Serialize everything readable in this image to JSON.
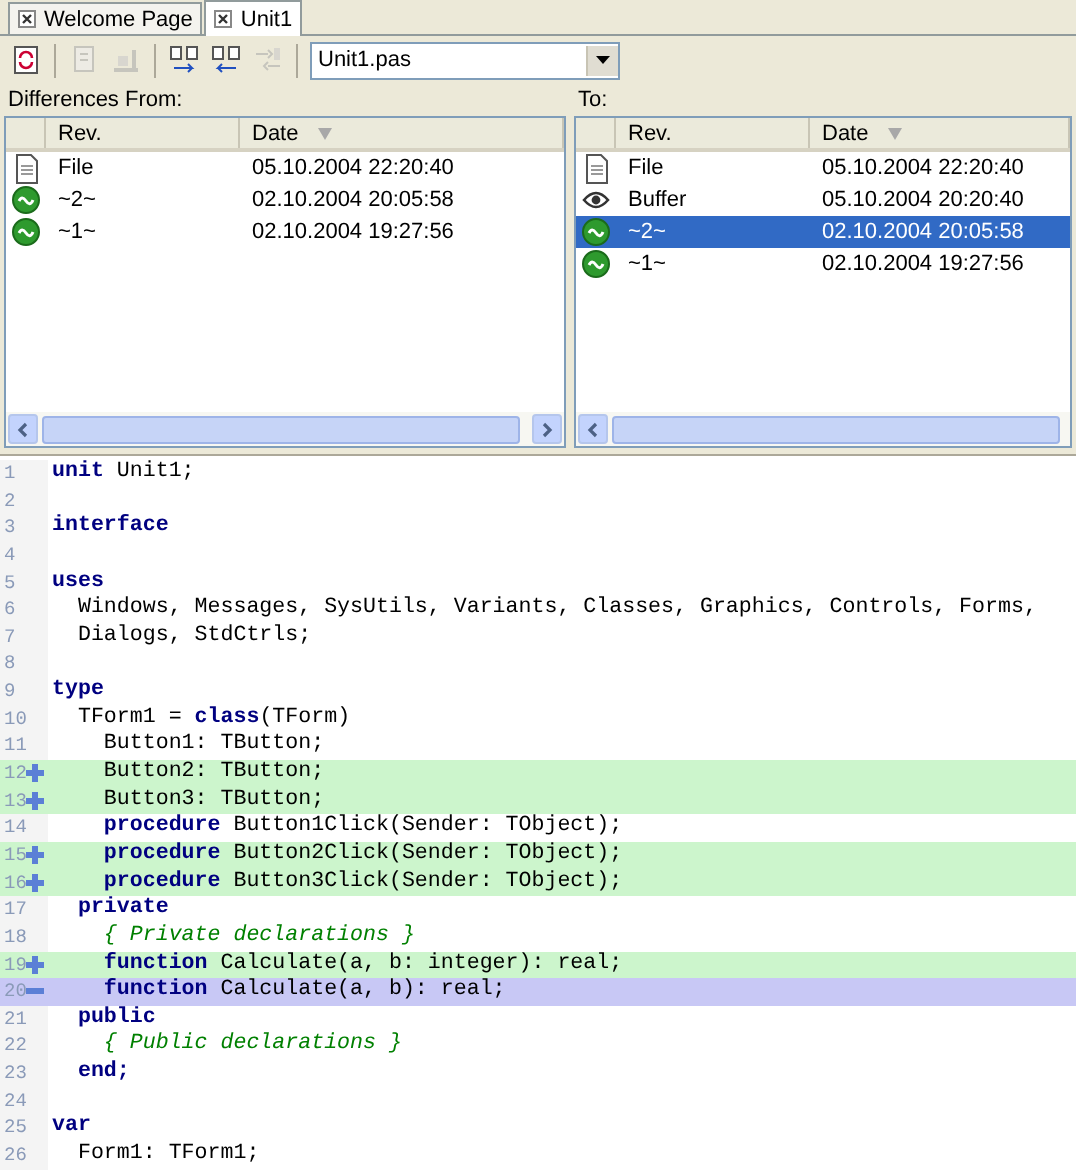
{
  "tabs": [
    {
      "label": "Welcome Page",
      "selected": false
    },
    {
      "label": "Unit1",
      "selected": true
    }
  ],
  "toolbar": {
    "buttons": [
      {
        "kind": "refresh",
        "disabled": false
      },
      {
        "kind": "revert",
        "disabled": true
      },
      {
        "kind": "merge",
        "disabled": true
      },
      {
        "kind": "next",
        "disabled": false
      },
      {
        "kind": "previous",
        "disabled": false
      },
      {
        "kind": "sync",
        "disabled": true
      }
    ],
    "file_select": {
      "value": "Unit1.pas"
    }
  },
  "from_pane": {
    "label": "Differences From:",
    "columns": [
      "Rev.",
      "Date"
    ],
    "rows": [
      {
        "kind": "file",
        "rev": "File",
        "date": "05.10.2004 22:20:40",
        "selected": false
      },
      {
        "kind": "revision",
        "rev": "~2~",
        "date": "02.10.2004 20:05:58",
        "selected": false
      },
      {
        "kind": "revision",
        "rev": "~1~",
        "date": "02.10.2004 19:27:56",
        "selected": false
      }
    ]
  },
  "to_pane": {
    "label": "To:",
    "columns": [
      "Rev.",
      "Date"
    ],
    "rows": [
      {
        "kind": "file",
        "rev": "File",
        "date": "05.10.2004 22:20:40",
        "selected": false
      },
      {
        "kind": "buffer",
        "rev": "Buffer",
        "date": "05.10.2004 20:20:40",
        "selected": false
      },
      {
        "kind": "revision",
        "rev": "~2~",
        "date": "02.10.2004 20:05:58",
        "selected": true
      },
      {
        "kind": "revision",
        "rev": "~1~",
        "date": "02.10.2004 19:27:56",
        "selected": false
      }
    ]
  },
  "code": {
    "lines": [
      {
        "number": "1",
        "added": false,
        "removed": false,
        "tokens": [
          {
            "kind": "keyword",
            "text": "unit"
          },
          {
            "kind": "plain",
            "text": " Unit1;"
          }
        ]
      },
      {
        "number": "2",
        "added": false,
        "removed": false
      },
      {
        "number": "3",
        "added": false,
        "removed": false,
        "tokens": [
          {
            "kind": "keyword",
            "text": "interface"
          }
        ]
      },
      {
        "number": "4",
        "added": false,
        "removed": false
      },
      {
        "number": "5",
        "added": false,
        "removed": false,
        "tokens": [
          {
            "kind": "keyword",
            "text": "uses"
          }
        ]
      },
      {
        "number": "6",
        "added": false,
        "removed": false,
        "tokens": [
          {
            "kind": "plain",
            "text": "  Windows, Messages, SysUtils, Variants, Classes, Graphics, Controls, Forms,"
          }
        ]
      },
      {
        "number": "7",
        "added": false,
        "removed": false,
        "tokens": [
          {
            "kind": "plain",
            "text": "  Dialogs, StdCtrls;"
          }
        ]
      },
      {
        "number": "8",
        "added": false,
        "removed": false
      },
      {
        "number": "9",
        "added": false,
        "removed": false,
        "tokens": [
          {
            "kind": "keyword",
            "text": "type"
          }
        ]
      },
      {
        "number": "10",
        "added": false,
        "removed": false,
        "tokens": [
          {
            "kind": "plain",
            "text": "  TForm1 = "
          },
          {
            "kind": "keyword",
            "text": "class"
          },
          {
            "kind": "plain",
            "text": "(TForm)"
          }
        ]
      },
      {
        "number": "11",
        "added": false,
        "removed": false,
        "tokens": [
          {
            "kind": "plain",
            "text": "    Button1: TButton;"
          }
        ]
      },
      {
        "number": "12",
        "added": true,
        "removed": false,
        "tokens": [
          {
            "kind": "plain",
            "text": "    Button2: TButton;"
          }
        ]
      },
      {
        "number": "13",
        "added": true,
        "removed": false,
        "tokens": [
          {
            "kind": "plain",
            "text": "    Button3: TButton;"
          }
        ]
      },
      {
        "number": "14",
        "added": false,
        "removed": false,
        "tokens": [
          {
            "kind": "keyword",
            "text": "    procedure"
          },
          {
            "kind": "plain",
            "text": " Button1Click(Sender: TObject);"
          }
        ]
      },
      {
        "number": "15",
        "added": true,
        "removed": false,
        "tokens": [
          {
            "kind": "keyword",
            "text": "    procedure"
          },
          {
            "kind": "plain",
            "text": " Button2Click(Sender: TObject);"
          }
        ]
      },
      {
        "number": "16",
        "added": true,
        "removed": false,
        "tokens": [
          {
            "kind": "keyword",
            "text": "    procedure"
          },
          {
            "kind": "plain",
            "text": " Button3Click(Sender: TObject);"
          }
        ]
      },
      {
        "number": "17",
        "added": false,
        "removed": false,
        "tokens": [
          {
            "kind": "keyword",
            "text": "  private"
          }
        ]
      },
      {
        "number": "18",
        "added": false,
        "removed": false,
        "tokens": [
          {
            "kind": "comment",
            "text": "    { Private declarations }"
          }
        ]
      },
      {
        "number": "19",
        "added": true,
        "removed": false,
        "tokens": [
          {
            "kind": "keyword",
            "text": "    function"
          },
          {
            "kind": "plain",
            "text": " Calculate(a, b: integer): real;"
          }
        ]
      },
      {
        "number": "20",
        "added": false,
        "removed": true,
        "tokens": [
          {
            "kind": "keyword",
            "text": "    function"
          },
          {
            "kind": "plain",
            "text": " Calculate(a, b): real;"
          }
        ]
      },
      {
        "number": "21",
        "added": false,
        "removed": false,
        "tokens": [
          {
            "kind": "keyword",
            "text": "  public"
          }
        ]
      },
      {
        "number": "22",
        "added": false,
        "removed": false,
        "tokens": [
          {
            "kind": "comment",
            "text": "    { Public declarations }"
          }
        ]
      },
      {
        "number": "23",
        "added": false,
        "removed": false,
        "tokens": [
          {
            "kind": "keyword",
            "text": "  end;"
          }
        ]
      },
      {
        "number": "24",
        "added": false,
        "removed": false
      },
      {
        "number": "25",
        "added": false,
        "removed": false,
        "tokens": [
          {
            "kind": "keyword",
            "text": "var"
          }
        ]
      },
      {
        "number": "26",
        "added": false,
        "removed": false,
        "tokens": [
          {
            "kind": "plain",
            "text": "  Form1: TForm1;"
          }
        ]
      }
    ]
  }
}
